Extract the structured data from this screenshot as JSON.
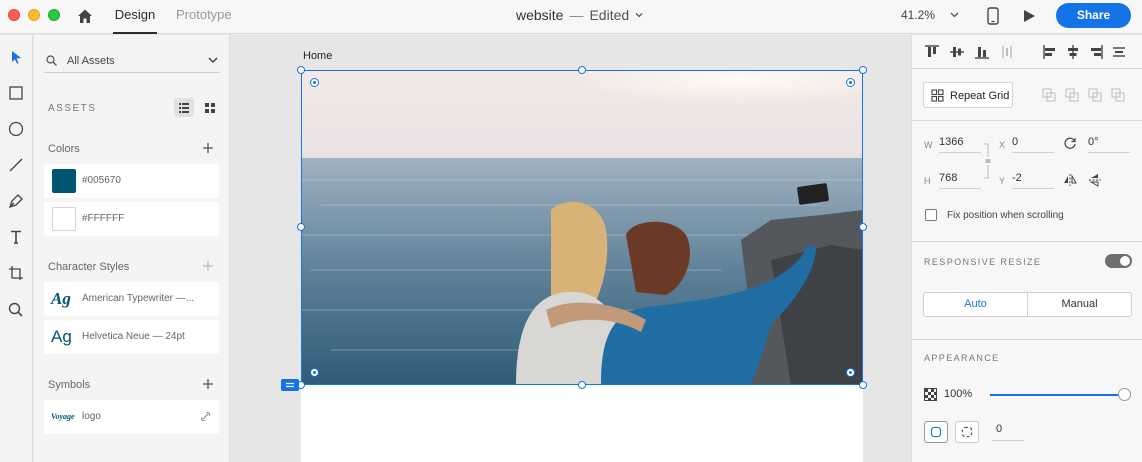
{
  "titlebar": {
    "tabs": {
      "design": "Design",
      "prototype": "Prototype"
    },
    "document_name": "website",
    "separator": "—",
    "status": "Edited",
    "zoom": "41.2%",
    "share_label": "Share"
  },
  "assets": {
    "search_label": "All Assets",
    "heading": "ASSETS",
    "colors": {
      "title": "Colors",
      "items": [
        {
          "hex": "#005670",
          "swatch": "#005670"
        },
        {
          "hex": "#FFFFFF",
          "swatch": "#FFFFFF"
        }
      ]
    },
    "character_styles": {
      "title": "Character Styles",
      "items": [
        {
          "glyph": "Ag",
          "label": "American Typewriter —..."
        },
        {
          "glyph": "Ag",
          "label": "Helvetica Neue — 24pt"
        }
      ]
    },
    "symbols": {
      "title": "Symbols",
      "items": [
        {
          "thumb": "Voyage",
          "label": "logo"
        }
      ]
    }
  },
  "canvas": {
    "artboard_name": "Home"
  },
  "inspector": {
    "repeat_grid_label": "Repeat Grid",
    "transform": {
      "w_label": "W",
      "w": "1366",
      "h_label": "H",
      "h": "768",
      "x_label": "X",
      "x": "0",
      "y_label": "Y",
      "y": "-2",
      "rotation": "0°"
    },
    "fix_position_label": "Fix position when scrolling",
    "responsive_resize": {
      "title": "RESPONSIVE RESIZE",
      "enabled": true,
      "auto_label": "Auto",
      "manual_label": "Manual"
    },
    "appearance": {
      "title": "APPEARANCE",
      "opacity": "100%",
      "opacity_value": 1.0,
      "corner_radius": "0"
    }
  },
  "colors": {
    "accent": "#1473e6",
    "brand": "#005670"
  }
}
